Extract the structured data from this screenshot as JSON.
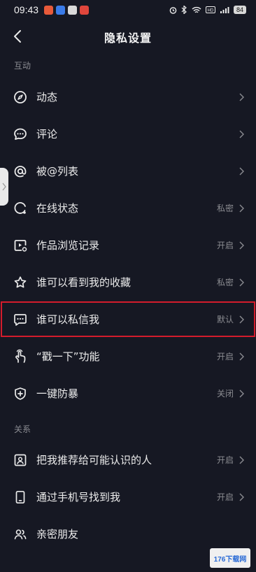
{
  "status_bar": {
    "time": "09:43",
    "battery": "84"
  },
  "header": {
    "title": "隐私设置",
    "back_icon": "chevron-left-icon"
  },
  "sections": [
    {
      "header": "互动",
      "items": [
        {
          "label": "动态",
          "value": "",
          "icon": "compass-icon"
        },
        {
          "label": "评论",
          "value": "",
          "icon": "comment-icon"
        },
        {
          "label": "被@列表",
          "value": "",
          "icon": "at-icon"
        },
        {
          "label": "在线状态",
          "value": "私密",
          "icon": "online-status-icon"
        },
        {
          "label": "作品浏览记录",
          "value": "开启",
          "icon": "video-history-icon"
        },
        {
          "label": "谁可以看到我的收藏",
          "value": "私密",
          "icon": "star-icon"
        },
        {
          "label": "谁可以私信我",
          "value": "默认",
          "icon": "message-icon",
          "highlighted": true
        },
        {
          "label": "“戳一下”功能",
          "value": "开启",
          "icon": "poke-hand-icon"
        },
        {
          "label": "一键防暴",
          "value": "关闭",
          "icon": "shield-plus-icon"
        }
      ]
    },
    {
      "header": "关系",
      "items": [
        {
          "label": "把我推荐给可能认识的人",
          "value": "开启",
          "icon": "contact-card-icon"
        },
        {
          "label": "通过手机号找到我",
          "value": "开启",
          "icon": "phone-icon"
        },
        {
          "label": "亲密朋友",
          "value": "",
          "icon": "friends-icon"
        }
      ]
    }
  ],
  "watermark": "176下载网"
}
